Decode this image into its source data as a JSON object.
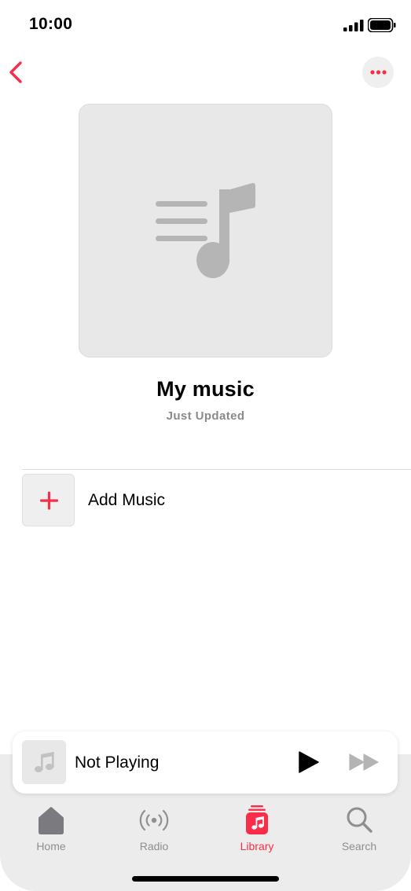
{
  "status_bar": {
    "time": "10:00",
    "icons": [
      "signal-icon",
      "battery-icon"
    ]
  },
  "nav": {
    "back_icon": "chevron-left-icon",
    "more_icon": "ellipsis-icon"
  },
  "playlist": {
    "artwork_icon": "playlist-note-icon",
    "title": "My music",
    "subtitle": "Just Updated"
  },
  "actions": {
    "add_music": {
      "icon": "plus-icon",
      "label": "Add Music"
    }
  },
  "mini_player": {
    "art_icon": "music-note-icon",
    "title": "Not Playing",
    "play_icon": "play-icon",
    "forward_icon": "forward-icon"
  },
  "tabs": [
    {
      "label": "Home",
      "icon": "home-icon",
      "active": false
    },
    {
      "label": "Radio",
      "icon": "radio-icon",
      "active": false
    },
    {
      "label": "Library",
      "icon": "library-icon",
      "active": true
    },
    {
      "label": "Search",
      "icon": "search-icon",
      "active": false
    }
  ],
  "colors": {
    "accent": "#fa2d48",
    "secondary_text": "#8e8e93",
    "artwork_bg": "#e8e8e8",
    "artwork_glyph": "#b5b5b5"
  }
}
